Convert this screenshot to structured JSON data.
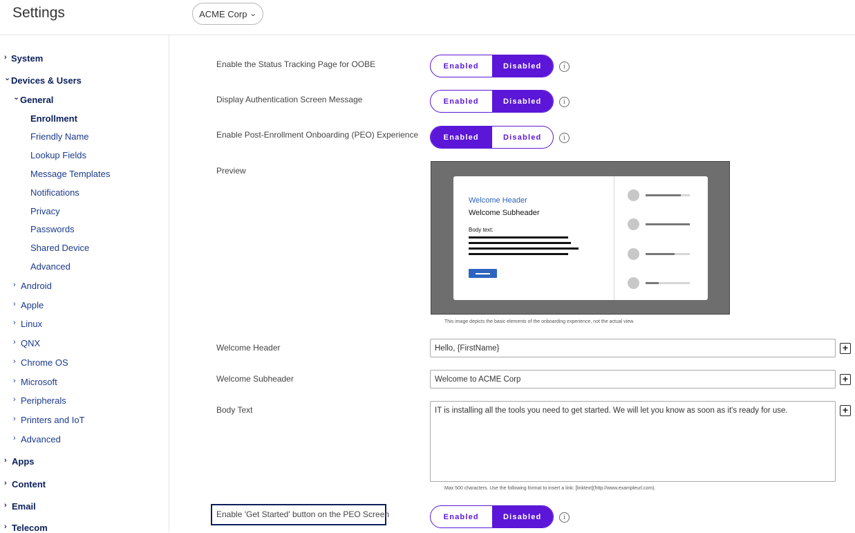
{
  "header": {
    "title": "Settings",
    "org_selector": "ACME Corp"
  },
  "sidebar": {
    "system": "System",
    "devices_users": "Devices & Users",
    "general": "General",
    "general_items": [
      "Enrollment",
      "Friendly Name",
      "Lookup Fields",
      "Message Templates",
      "Notifications",
      "Privacy",
      "Passwords",
      "Shared Device",
      "Advanced"
    ],
    "platforms": [
      "Android",
      "Apple",
      "Linux",
      "QNX",
      "Chrome OS",
      "Microsoft",
      "Peripherals",
      "Printers and IoT",
      "Advanced"
    ],
    "bottom": [
      "Apps",
      "Content",
      "Email",
      "Telecom"
    ],
    "active": "Enrollment"
  },
  "settings": {
    "toggle_enabled": "Enabled",
    "toggle_disabled": "Disabled",
    "status_tracking": {
      "label": "Enable the Status Tracking Page for OOBE",
      "value": "Disabled"
    },
    "auth_message": {
      "label": "Display Authentication Screen Message",
      "value": "Disabled"
    },
    "peo_experience": {
      "label": "Enable Post-Enrollment Onboarding (PEO) Experience",
      "value": "Enabled"
    },
    "get_started": {
      "label": "Enable 'Get Started' button on the PEO Screen",
      "value": "Disabled"
    }
  },
  "preview": {
    "label": "Preview",
    "welcome_header": "Welcome Header",
    "welcome_subheader": "Welcome Subheader",
    "body_text": "Body text:",
    "progress_levels": [
      0.8,
      1.0,
      0.65,
      0.3
    ],
    "caption": "This image depicts the basic elements of the onboarding experience, not the actual view."
  },
  "fields": {
    "welcome_header": {
      "label": "Welcome Header",
      "value": "Hello, {FirstName}"
    },
    "welcome_subheader": {
      "label": "Welcome Subheader",
      "value": "Welcome to ACME Corp"
    },
    "body_text": {
      "label": "Body Text",
      "value": "IT is installing all the tools you need to get started. We will let you know as soon as it's ready for use."
    },
    "body_hint": "Max 500 characters. Use the following format to insert a link: [linktext](http://www.exampleurl.com).",
    "insert_symbol": "+"
  },
  "icons": {
    "info": "info-circle-icon",
    "insert": "plus-square-icon",
    "chevron": "chevron-right-icon"
  },
  "colors": {
    "accent": "#5b16d8",
    "nav": "#0b1f5c",
    "preview_link": "#2b62b8"
  }
}
